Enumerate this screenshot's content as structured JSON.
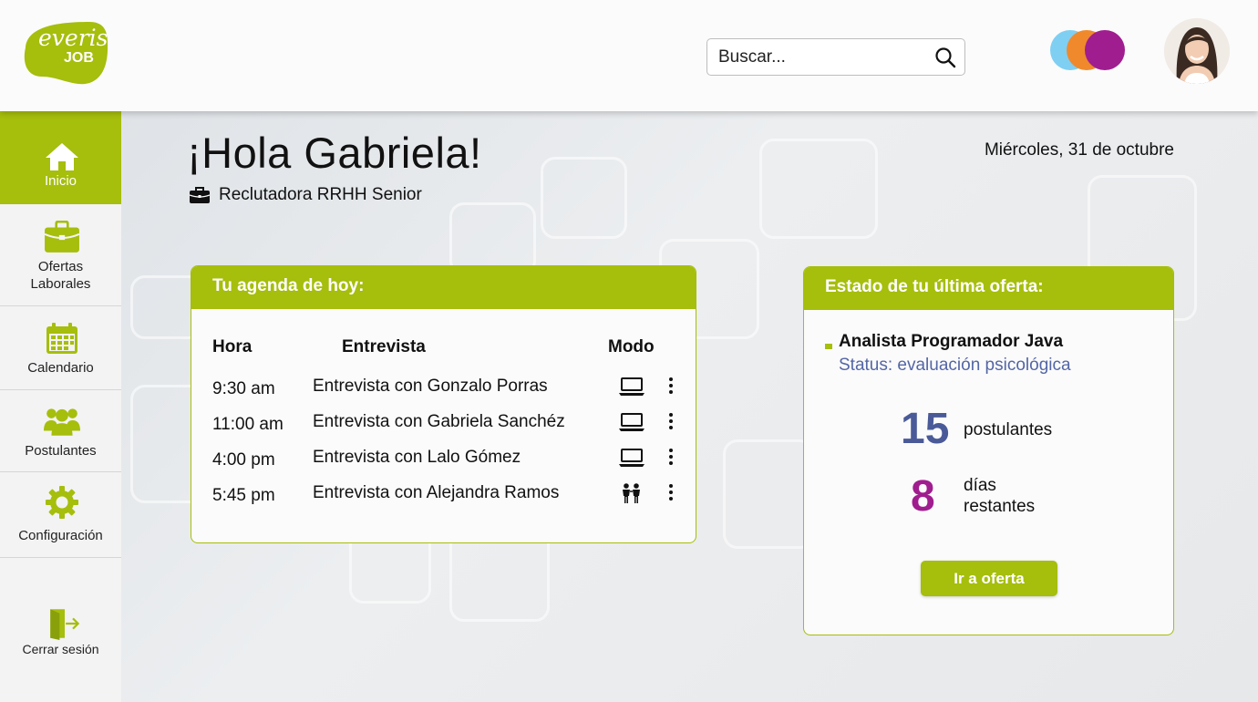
{
  "brand": {
    "logo_line1": "everis",
    "logo_line2": "JOB",
    "color": "#a6be0c"
  },
  "header": {
    "search_placeholder": "Buscar...",
    "circle_colors": [
      "#7fcff3",
      "#f0892c",
      "#a01d8f"
    ]
  },
  "sidebar": {
    "items": [
      {
        "label": "Inicio",
        "icon": "home-icon",
        "active": true
      },
      {
        "label": "Ofertas\nLaborales",
        "icon": "briefcase-icon",
        "active": false
      },
      {
        "label": "Calendario",
        "icon": "calendar-icon",
        "active": false
      },
      {
        "label": "Postulantes",
        "icon": "users-icon",
        "active": false
      },
      {
        "label": "Configuración",
        "icon": "gear-icon",
        "active": false
      }
    ],
    "logout_label": "Cerrar sesión"
  },
  "greeting": {
    "title": "¡Hola Gabriela!",
    "role": "Reclutadora RRHH Senior",
    "date": "Miércoles, 31 de octubre"
  },
  "agenda": {
    "title": "Tu agenda de hoy:",
    "columns": [
      "Hora",
      "Entrevista",
      "Modo"
    ],
    "rows": [
      {
        "time": "9:30 am",
        "name": "Entrevista con Gonzalo Porras",
        "mode": "laptop-icon"
      },
      {
        "time": "11:00 am",
        "name": "Entrevista con Gabriela Sanchéz",
        "mode": "laptop-icon"
      },
      {
        "time": "4:00 pm",
        "name": "Entrevista con Lalo Gómez",
        "mode": "laptop-icon"
      },
      {
        "time": "5:45 pm",
        "name": "Entrevista con Alejandra Ramos",
        "mode": "in-person-icon"
      }
    ]
  },
  "offer": {
    "title": "Estado de tu última oferta:",
    "job": "Analista Programador Java",
    "status": "Status: evaluación psicológica",
    "applicants_count": "15",
    "applicants_label": "postulantes",
    "days_count": "8",
    "days_label_1": "días",
    "days_label_2": "restantes",
    "button_label": "Ir a oferta",
    "accent_blue": "#4a5a98",
    "accent_purple": "#a01d8f"
  }
}
